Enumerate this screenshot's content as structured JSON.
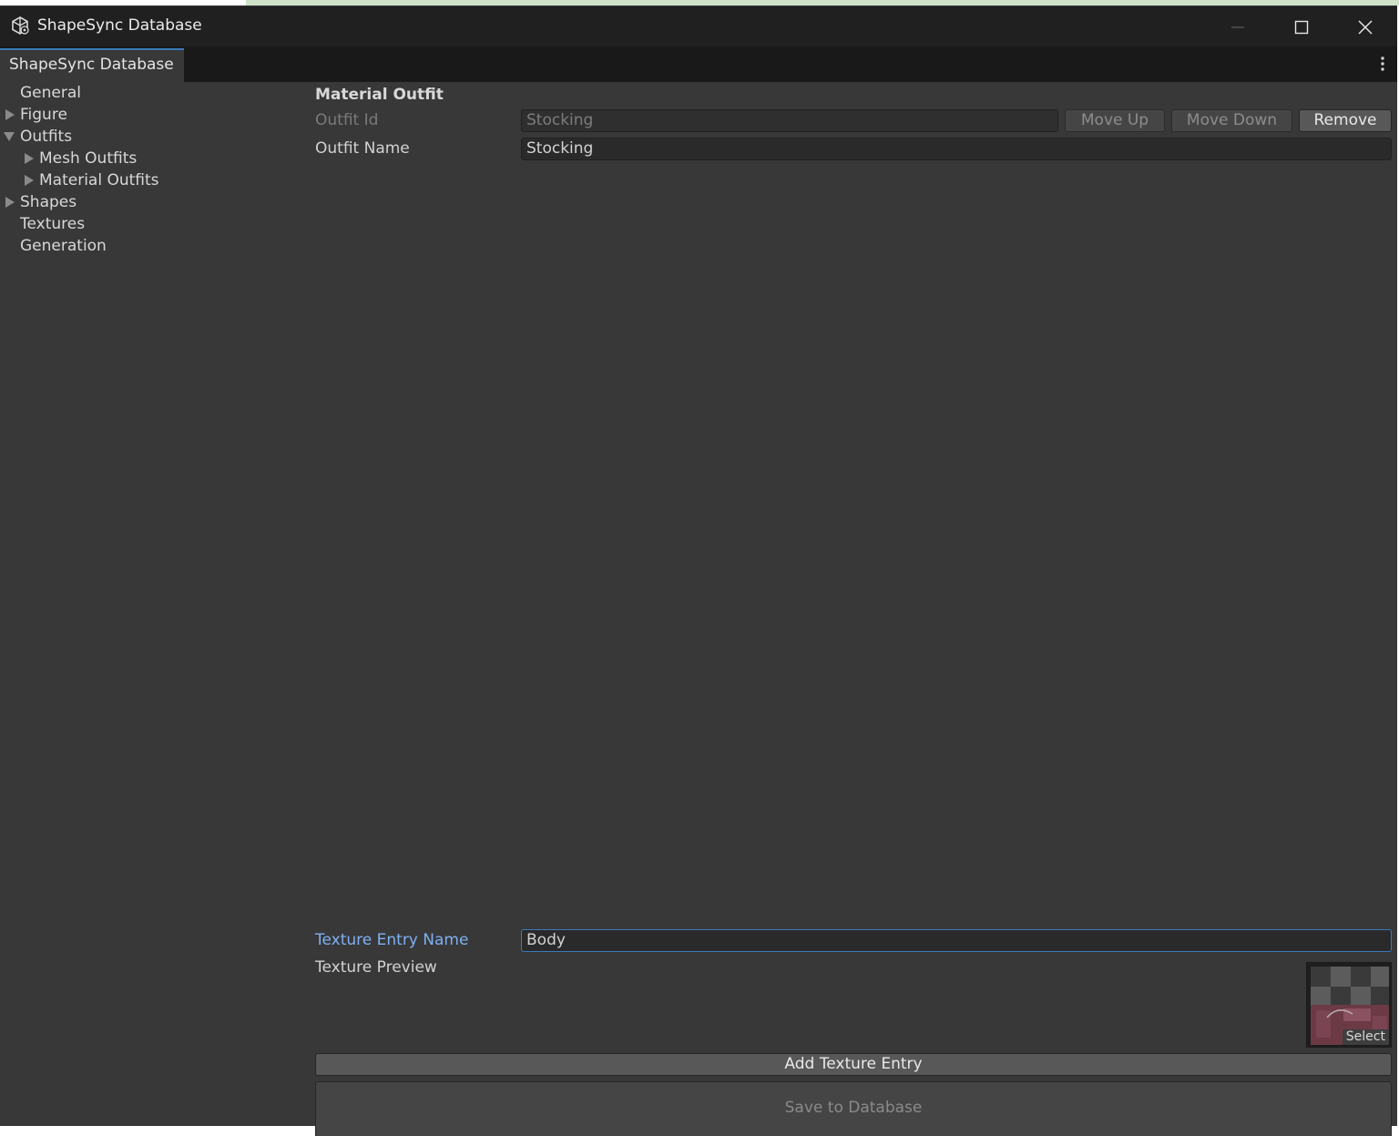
{
  "window": {
    "title": "ShapeSync Database",
    "icon": "unity-cube-icon"
  },
  "tab": {
    "label": "ShapeSync Database"
  },
  "sidebar": {
    "items": [
      {
        "label": "General",
        "expander": "none"
      },
      {
        "label": "Figure",
        "expander": "collapsed"
      },
      {
        "label": "Outfits",
        "expander": "expanded"
      },
      {
        "label": "Mesh Outfits",
        "expander": "collapsed"
      },
      {
        "label": "Material Outfits",
        "expander": "collapsed"
      },
      {
        "label": "Shapes",
        "expander": "collapsed"
      },
      {
        "label": "Textures",
        "expander": "none"
      },
      {
        "label": "Generation",
        "expander": "none"
      }
    ]
  },
  "main": {
    "section_title": "Material Outfit",
    "outfit_id": {
      "label": "Outfit Id",
      "value": "Stocking"
    },
    "outfit_name": {
      "label": "Outfit Name",
      "value": "Stocking"
    },
    "buttons": {
      "move_up": "Move Up",
      "move_down": "Move Down",
      "remove": "Remove"
    },
    "texture_entry_name": {
      "label": "Texture Entry Name",
      "value": "Body"
    },
    "texture_preview": {
      "label": "Texture Preview",
      "select_label": "Select"
    },
    "add_texture_entry": "Add Texture Entry",
    "save_to_database": "Save to Database"
  },
  "colors": {
    "window_bg": "#383838",
    "titlebar_bg": "#202020",
    "focus_accent": "#3a79bb",
    "focus_label": "#7fb0f2"
  }
}
